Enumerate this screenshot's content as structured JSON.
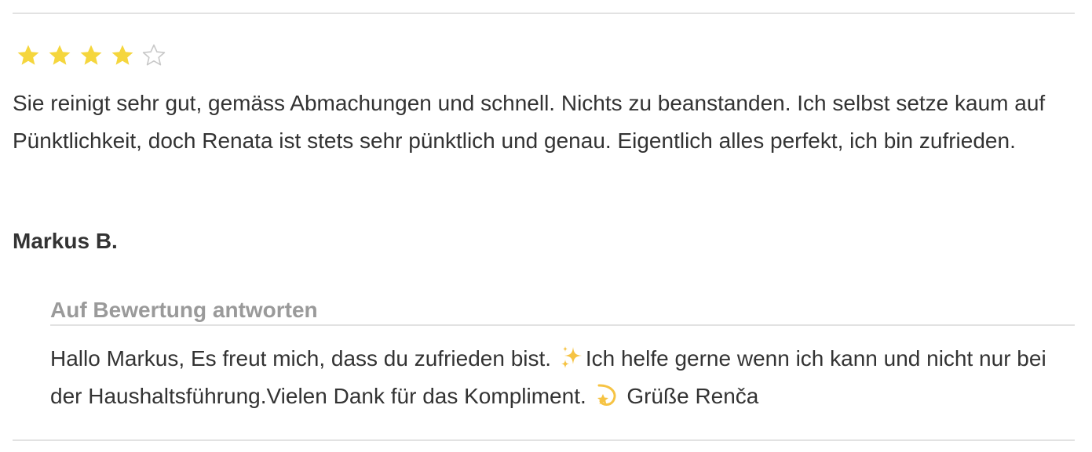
{
  "review": {
    "rating": 4,
    "rating_max": 5,
    "star_filled_color": "#f5d63d",
    "star_empty_color": "#c8c8c8",
    "text": "Sie reinigt sehr gut, gemäss Abmachungen und schnell. Nichts zu beanstanden. Ich selbst setze kaum auf Pünktlichkeit, doch Renata ist stets sehr pünktlich und genau. Eigentlich alles perfekt, ich bin zufrieden.",
    "author": "Markus B."
  },
  "reply": {
    "heading": "Auf Bewertung antworten",
    "text_part1": "Hallo Markus, Es freut mich, dass du zufrieden bist.",
    "emoji1": "sparkles-icon",
    "text_part2": "Ich helfe gerne wenn ich kann und nicht nur bei der Haushaltsführung.Vielen Dank für das Kompliment.",
    "emoji2": "dizzy-star-icon",
    "text_part3": "Grüße Renča"
  }
}
